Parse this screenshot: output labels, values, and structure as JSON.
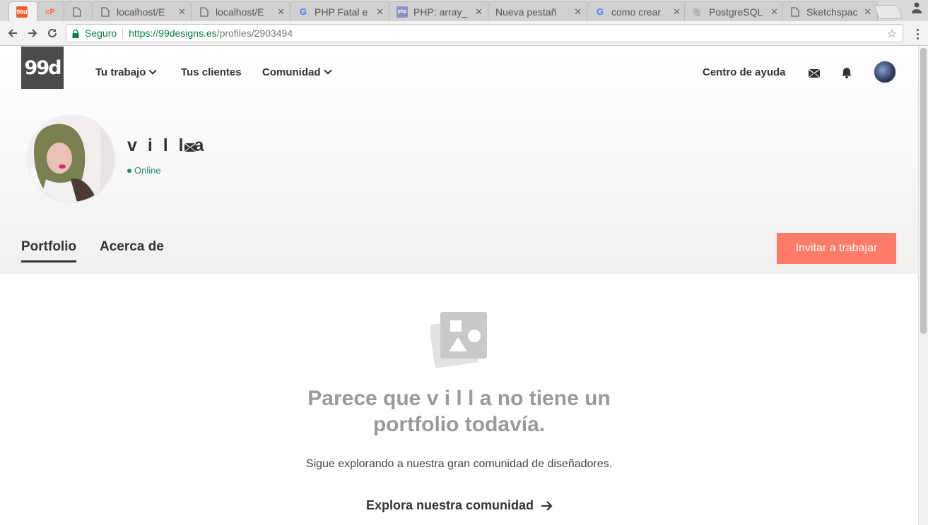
{
  "browser": {
    "tabs": [
      {
        "title": "",
        "favicon": "99d"
      },
      {
        "title": "",
        "favicon": "cP"
      },
      {
        "title": "",
        "favicon": "doc"
      },
      {
        "title": "localhost/E",
        "favicon": "doc"
      },
      {
        "title": "localhost/E",
        "favicon": "doc"
      },
      {
        "title": "PHP Fatal e",
        "favicon": "G"
      },
      {
        "title": "PHP: array_",
        "favicon": "php"
      },
      {
        "title": "Nueva pestañ",
        "favicon": ""
      },
      {
        "title": "como crear",
        "favicon": "G"
      },
      {
        "title": "PostgreSQL",
        "favicon": "pg"
      },
      {
        "title": "Sketchspac",
        "favicon": "doc"
      }
    ],
    "secure_label": "Seguro",
    "url_host": "https://99designs.es",
    "url_path": "/profiles/2903494"
  },
  "site": {
    "logo": "99d",
    "nav": {
      "work": "Tu trabajo",
      "clients": "Tus clientes",
      "community": "Comunidad",
      "help": "Centro de ayuda"
    }
  },
  "profile": {
    "name": "v i l l a",
    "status": "Online",
    "tabs": {
      "portfolio": "Portfolio",
      "about": "Acerca de"
    },
    "invite_label": "Invitar a trabajar"
  },
  "empty": {
    "title_line1": "Parece que v i l l a no tiene un",
    "title_line2": "portfolio todavía.",
    "subtitle": "Sigue explorando a nuestra gran comunidad de diseñadores.",
    "cta": "Explora nuestra comunidad"
  },
  "colors": {
    "accent": "#fd7b68",
    "online": "#1b8a73",
    "logo_bg": "#4a4a4a"
  }
}
